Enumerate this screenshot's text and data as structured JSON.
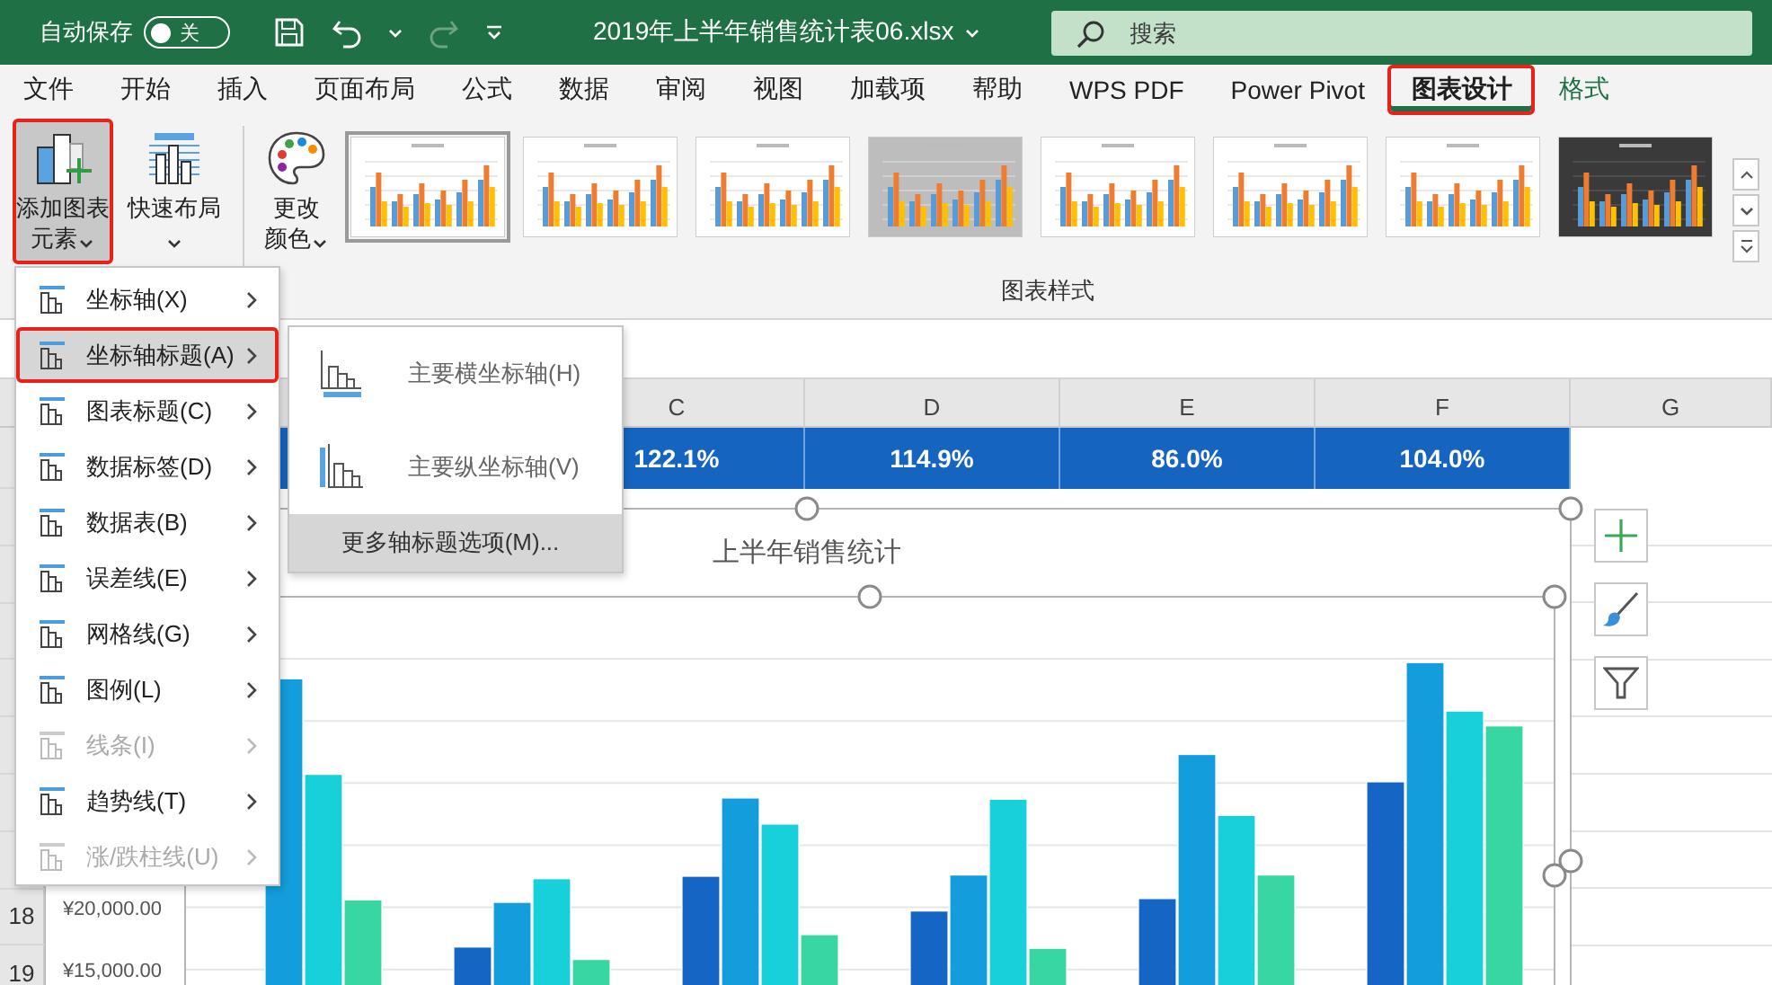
{
  "title_bar": {
    "autosave_label": "自动保存",
    "autosave_toggle": {
      "on": false,
      "label": "关"
    },
    "file_name": "2019年上半年销售统计表06.xlsx",
    "search": {
      "placeholder": "搜索"
    }
  },
  "tabs": [
    {
      "label": "文件",
      "selected": false,
      "contextual": false,
      "outlined": false
    },
    {
      "label": "开始",
      "selected": false,
      "contextual": false,
      "outlined": false
    },
    {
      "label": "插入",
      "selected": false,
      "contextual": false,
      "outlined": false
    },
    {
      "label": "页面布局",
      "selected": false,
      "contextual": false,
      "outlined": false
    },
    {
      "label": "公式",
      "selected": false,
      "contextual": false,
      "outlined": false
    },
    {
      "label": "数据",
      "selected": false,
      "contextual": false,
      "outlined": false
    },
    {
      "label": "审阅",
      "selected": false,
      "contextual": false,
      "outlined": false
    },
    {
      "label": "视图",
      "selected": false,
      "contextual": false,
      "outlined": false
    },
    {
      "label": "加载项",
      "selected": false,
      "contextual": false,
      "outlined": false
    },
    {
      "label": "帮助",
      "selected": false,
      "contextual": false,
      "outlined": false
    },
    {
      "label": "WPS PDF",
      "selected": false,
      "contextual": false,
      "outlined": false
    },
    {
      "label": "Power Pivot",
      "selected": false,
      "contextual": false,
      "outlined": false
    },
    {
      "label": "图表设计",
      "selected": true,
      "contextual": true,
      "outlined": true
    },
    {
      "label": "格式",
      "selected": false,
      "contextual": true,
      "outlined": false
    }
  ],
  "ribbon": {
    "buttons": [
      {
        "label": "添加图表元素",
        "kind": "add",
        "pressed": true,
        "outlined": true
      },
      {
        "label": "快速布局",
        "kind": "layout",
        "pressed": false,
        "outlined": false
      },
      {
        "label": "更改颜色",
        "kind": "colors",
        "pressed": false,
        "outlined": false
      }
    ],
    "chart_styles": [
      {
        "kind": "light",
        "selected": true
      },
      {
        "kind": "light",
        "selected": false
      },
      {
        "kind": "light",
        "selected": false
      },
      {
        "kind": "gray",
        "selected": false
      },
      {
        "kind": "light",
        "selected": false
      },
      {
        "kind": "light",
        "selected": false
      },
      {
        "kind": "light",
        "selected": false
      },
      {
        "kind": "dark",
        "selected": false
      }
    ],
    "group_label": "图表样式"
  },
  "sheet": {
    "columns": [
      "C",
      "D",
      "E",
      "F",
      "G"
    ],
    "highlight_row": [
      "122.1%",
      "114.9%",
      "86.0%",
      "104.0%"
    ],
    "row_numbers": [
      "18",
      "19"
    ]
  },
  "chart": {
    "chart_data": {
      "type": "bar",
      "title": "上半年销售统计",
      "ylim": [
        0,
        45000
      ],
      "yticks": [
        {
          "value": 15000,
          "label": "¥15,000.00"
        },
        {
          "value": 20000,
          "label": "¥20,000.00"
        }
      ],
      "series": [
        {
          "color": "#1565c4",
          "values": [
            null,
            16800,
            22500,
            19700,
            20700,
            30100
          ]
        },
        {
          "color": "#139ddc",
          "values": [
            38400,
            20400,
            28800,
            22600,
            32300,
            39700
          ]
        },
        {
          "color": "#18d0da",
          "values": [
            30700,
            22300,
            26700,
            28700,
            27400,
            35800
          ]
        },
        {
          "color": "#38d6a2",
          "values": [
            20600,
            15800,
            17800,
            16700,
            22600,
            34600
          ]
        }
      ]
    }
  },
  "menu": {
    "items": [
      {
        "label": "坐标轴(X)",
        "disabled": false,
        "selected": false,
        "outlined": false
      },
      {
        "label": "坐标轴标题(A)",
        "disabled": false,
        "selected": true,
        "outlined": true
      },
      {
        "label": "图表标题(C)",
        "disabled": false,
        "selected": false,
        "outlined": false
      },
      {
        "label": "数据标签(D)",
        "disabled": false,
        "selected": false,
        "outlined": false
      },
      {
        "label": "数据表(B)",
        "disabled": false,
        "selected": false,
        "outlined": false
      },
      {
        "label": "误差线(E)",
        "disabled": false,
        "selected": false,
        "outlined": false
      },
      {
        "label": "网格线(G)",
        "disabled": false,
        "selected": false,
        "outlined": false
      },
      {
        "label": "图例(L)",
        "disabled": false,
        "selected": false,
        "outlined": false
      },
      {
        "label": "线条(I)",
        "disabled": true,
        "selected": false,
        "outlined": false
      },
      {
        "label": "趋势线(T)",
        "disabled": false,
        "selected": false,
        "outlined": false
      },
      {
        "label": "涨/跌柱线(U)",
        "disabled": true,
        "selected": false,
        "outlined": false
      }
    ]
  },
  "submenu": {
    "items": [
      {
        "label": "主要横坐标轴(H)",
        "kind": "horizontal",
        "selected": false
      },
      {
        "label": "主要纵坐标轴(V)",
        "kind": "vertical",
        "selected": false
      },
      {
        "label": "更多轴标题选项(M)...",
        "kind": "text",
        "selected": true
      }
    ]
  }
}
